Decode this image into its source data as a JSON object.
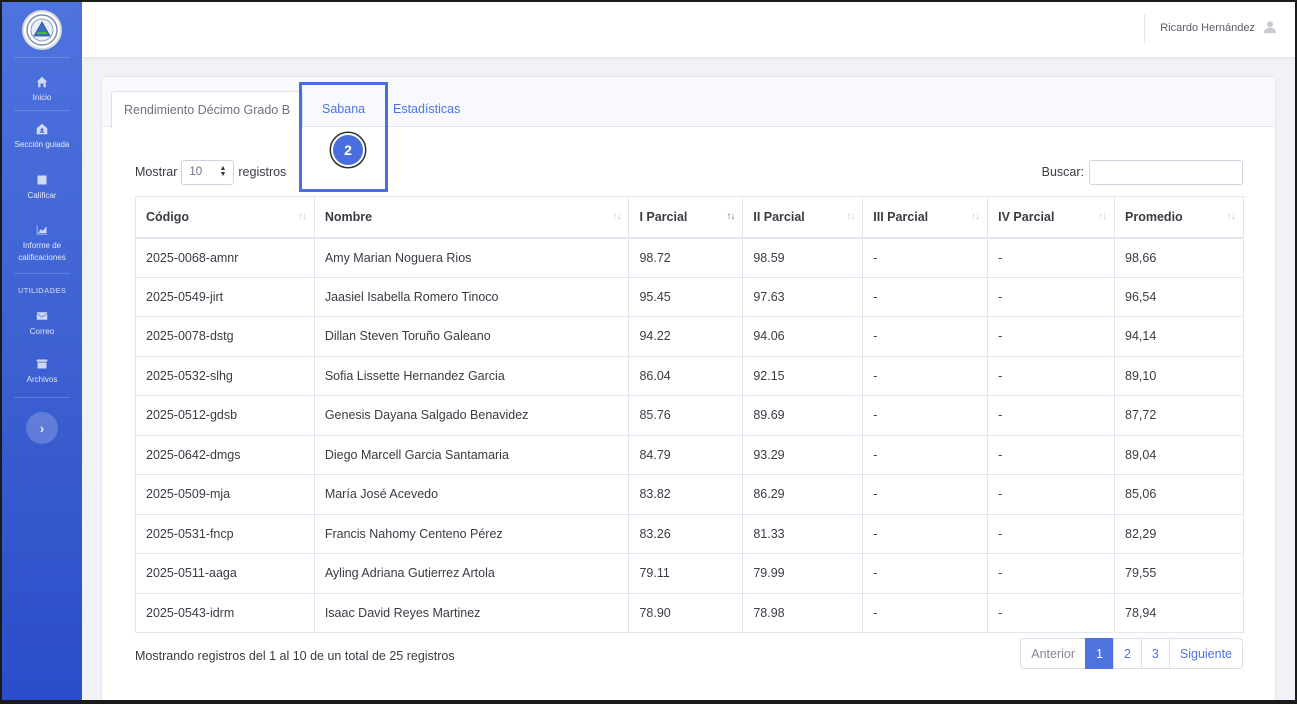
{
  "colors": {
    "primary": "#4e73df",
    "highlight": "#4a6fdc"
  },
  "sidebar": {
    "logo_icon": "school-seal-logo",
    "items": [
      {
        "label": "Inicio",
        "icon": "home-icon"
      },
      {
        "label": "Sección guiada",
        "icon": "house-user-icon"
      },
      {
        "label": "Calificar",
        "icon": "clipboard-icon"
      },
      {
        "label": "Informe de calificaciones",
        "icon": "chart-area-icon"
      }
    ],
    "section_heading": "UTILIDADES",
    "utility_items": [
      {
        "label": "Correo",
        "icon": "envelope-icon"
      },
      {
        "label": "Archivos",
        "icon": "archive-icon"
      }
    ],
    "toggle_icon": "chevron-right-icon",
    "toggle_glyph": "›"
  },
  "topbar": {
    "user_name": "Ricardo Hernández",
    "user_icon": "user-icon"
  },
  "tabs": [
    {
      "label": "Rendimiento Décimo Grado B"
    },
    {
      "label": "Sabana"
    },
    {
      "label": "Estadísticas"
    }
  ],
  "step_badge": "2",
  "controls": {
    "show_label": "Mostrar",
    "page_length": "10",
    "records_label": "registros",
    "search_label": "Buscar:",
    "search_value": ""
  },
  "table": {
    "headers": [
      "Código",
      "Nombre",
      "I Parcial",
      "II Parcial",
      "III Parcial",
      "IV Parcial",
      "Promedio"
    ],
    "sort_icons": [
      "↑↓",
      "↑↓",
      "↑↓",
      "↑↓",
      "↑↓",
      "↑↓",
      "↑↓"
    ],
    "rows": [
      [
        "2025-0068-amnr",
        "Amy Marian Noguera Rios",
        "98.72",
        "98.59",
        "-",
        "-",
        "98,66"
      ],
      [
        "2025-0549-jirt",
        "Jaasiel Isabella Romero Tinoco",
        "95.45",
        "97.63",
        "-",
        "-",
        "96,54"
      ],
      [
        "2025-0078-dstg",
        "Dillan Steven Toruño Galeano",
        "94.22",
        "94.06",
        "-",
        "-",
        "94,14"
      ],
      [
        "2025-0532-slhg",
        "Sofia Lissette Hernandez Garcia",
        "86.04",
        "92.15",
        "-",
        "-",
        "89,10"
      ],
      [
        "2025-0512-gdsb",
        "Genesis Dayana Salgado Benavidez",
        "85.76",
        "89.69",
        "-",
        "-",
        "87,72"
      ],
      [
        "2025-0642-dmgs",
        "Diego Marcell Garcia Santamaria",
        "84.79",
        "93.29",
        "-",
        "-",
        "89,04"
      ],
      [
        "2025-0509-mja",
        "María José Acevedo",
        "83.82",
        "86.29",
        "-",
        "-",
        "85,06"
      ],
      [
        "2025-0531-fncp",
        "Francis Nahomy Centeno Pérez",
        "83.26",
        "81.33",
        "-",
        "-",
        "82,29"
      ],
      [
        "2025-0511-aaga",
        "Ayling Adriana Gutierrez Artola",
        "79.11",
        "79.99",
        "-",
        "-",
        "79,55"
      ],
      [
        "2025-0543-idrm",
        "Isaac David Reyes Martinez",
        "78.90",
        "78.98",
        "-",
        "-",
        "78,94"
      ]
    ]
  },
  "footer": {
    "info": "Mostrando registros del 1 al 10 de un total de 25 registros",
    "pagination": {
      "previous": "Anterior",
      "pages": [
        "1",
        "2",
        "3"
      ],
      "next": "Siguiente",
      "current": "1"
    }
  }
}
